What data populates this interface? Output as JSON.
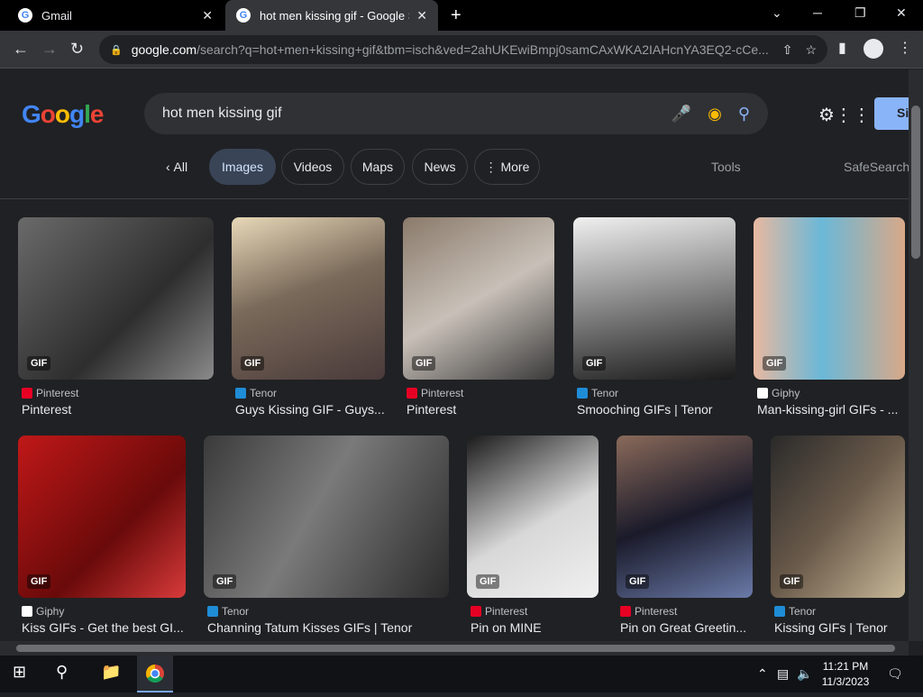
{
  "browser": {
    "tabs": [
      {
        "favicon": "G",
        "title": "Gmail",
        "close": "✕"
      },
      {
        "favicon": "G",
        "title": "hot men kissing gif - Google Search",
        "close": "✕"
      }
    ],
    "new_tab": "+",
    "window_controls": {
      "chevron": "⌄",
      "minimize": "─",
      "restore": "❐",
      "close": "✕"
    },
    "nav": {
      "back": "←",
      "forward": "→",
      "reload": "↻"
    },
    "address": {
      "host": "google.com",
      "path": "/search?q=hot+men+kissing+gif&tbm=isch&ved=2ahUKEwiBmpj0samCAxWKA2IAHcnYA3EQ2-cCe..."
    }
  },
  "google": {
    "logo": {
      "g1": "G",
      "o1": "o",
      "o2": "o",
      "g2": "g",
      "l": "l",
      "e": "e"
    },
    "search_query": "hot men kissing gif",
    "signin_label": "Si",
    "chips": {
      "all": "All",
      "images": "Images",
      "videos": "Videos",
      "maps": "Maps",
      "news": "News",
      "more": "More"
    },
    "tools": "Tools",
    "safesearch": "SafeSearch",
    "results": [
      {
        "source": "Pinterest",
        "title": "Pinterest",
        "badge": "GIF"
      },
      {
        "source": "Tenor",
        "title": "Guys Kissing GIF - Guys...",
        "badge": "GIF"
      },
      {
        "source": "Pinterest",
        "title": "Pinterest",
        "badge": "GIF"
      },
      {
        "source": "Tenor",
        "title": "Smooching GIFs | Tenor",
        "badge": "GIF"
      },
      {
        "source": "Giphy",
        "title": "Man-kissing-girl GIFs - ...",
        "badge": "GIF"
      },
      {
        "source": "Giphy",
        "title": "Kiss GIFs - Get the best GI...",
        "badge": "GIF"
      },
      {
        "source": "Tenor",
        "title": "Channing Tatum Kisses GIFs | Tenor",
        "badge": "GIF"
      },
      {
        "source": "Pinterest",
        "title": "Pin on MINE",
        "badge": "GIF"
      },
      {
        "source": "Pinterest",
        "title": "Pin on Great Greetin...",
        "badge": "GIF"
      },
      {
        "source": "Tenor",
        "title": "Kissing GIFs | Tenor",
        "badge": "GIF"
      }
    ]
  },
  "taskbar": {
    "time": "11:21 PM",
    "date": "11/3/2023"
  },
  "colors": {
    "page_bg": "#202124",
    "pinterest": "#e60023",
    "tenor": "#1f8cd6",
    "giphy": "#ffffff",
    "accent_chip": "#394457"
  }
}
